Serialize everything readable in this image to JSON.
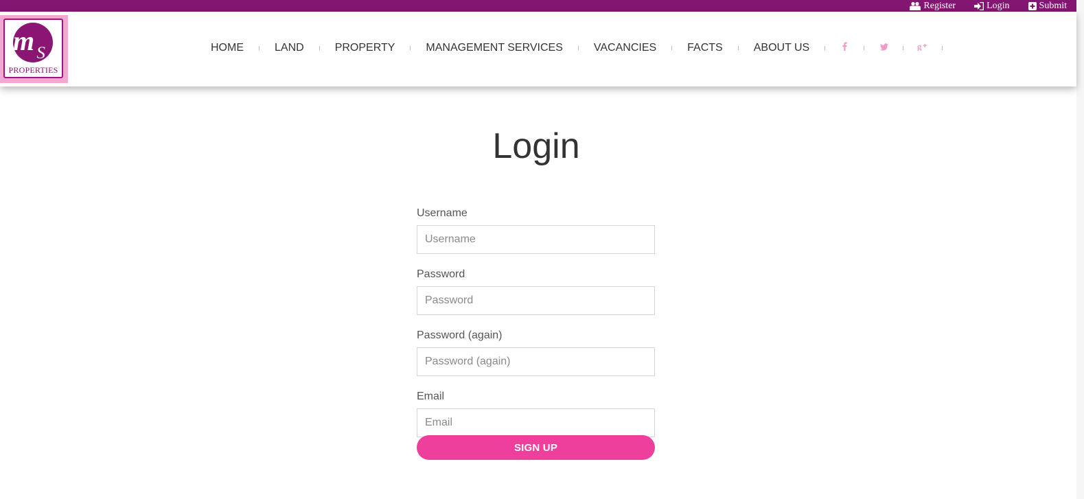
{
  "topbar": {
    "register": "Register",
    "login": "Login",
    "submit": "Submit",
    "color": "#841673"
  },
  "logo": {
    "monogram": "ms",
    "text": "PROPERTIES"
  },
  "nav": {
    "items": [
      "HOME",
      "LAND",
      "PROPERTY",
      "MANAGEMENT SERVICES",
      "VACANCIES",
      "FACTS",
      "ABOUT US"
    ],
    "social_icons": [
      "facebook-icon",
      "twitter-icon",
      "google-plus-icon"
    ],
    "social_color": "#ee9cc7"
  },
  "page": {
    "title": "Login"
  },
  "form": {
    "username_label": "Username",
    "username_placeholder": "Username",
    "password_label": "Password",
    "password_placeholder": "Password",
    "password_again_label": "Password (again)",
    "password_again_placeholder": "Password (again)",
    "email_label": "Email",
    "email_placeholder": "Email",
    "submit_label": "SIGN UP",
    "button_color": "#ef3f9d"
  }
}
